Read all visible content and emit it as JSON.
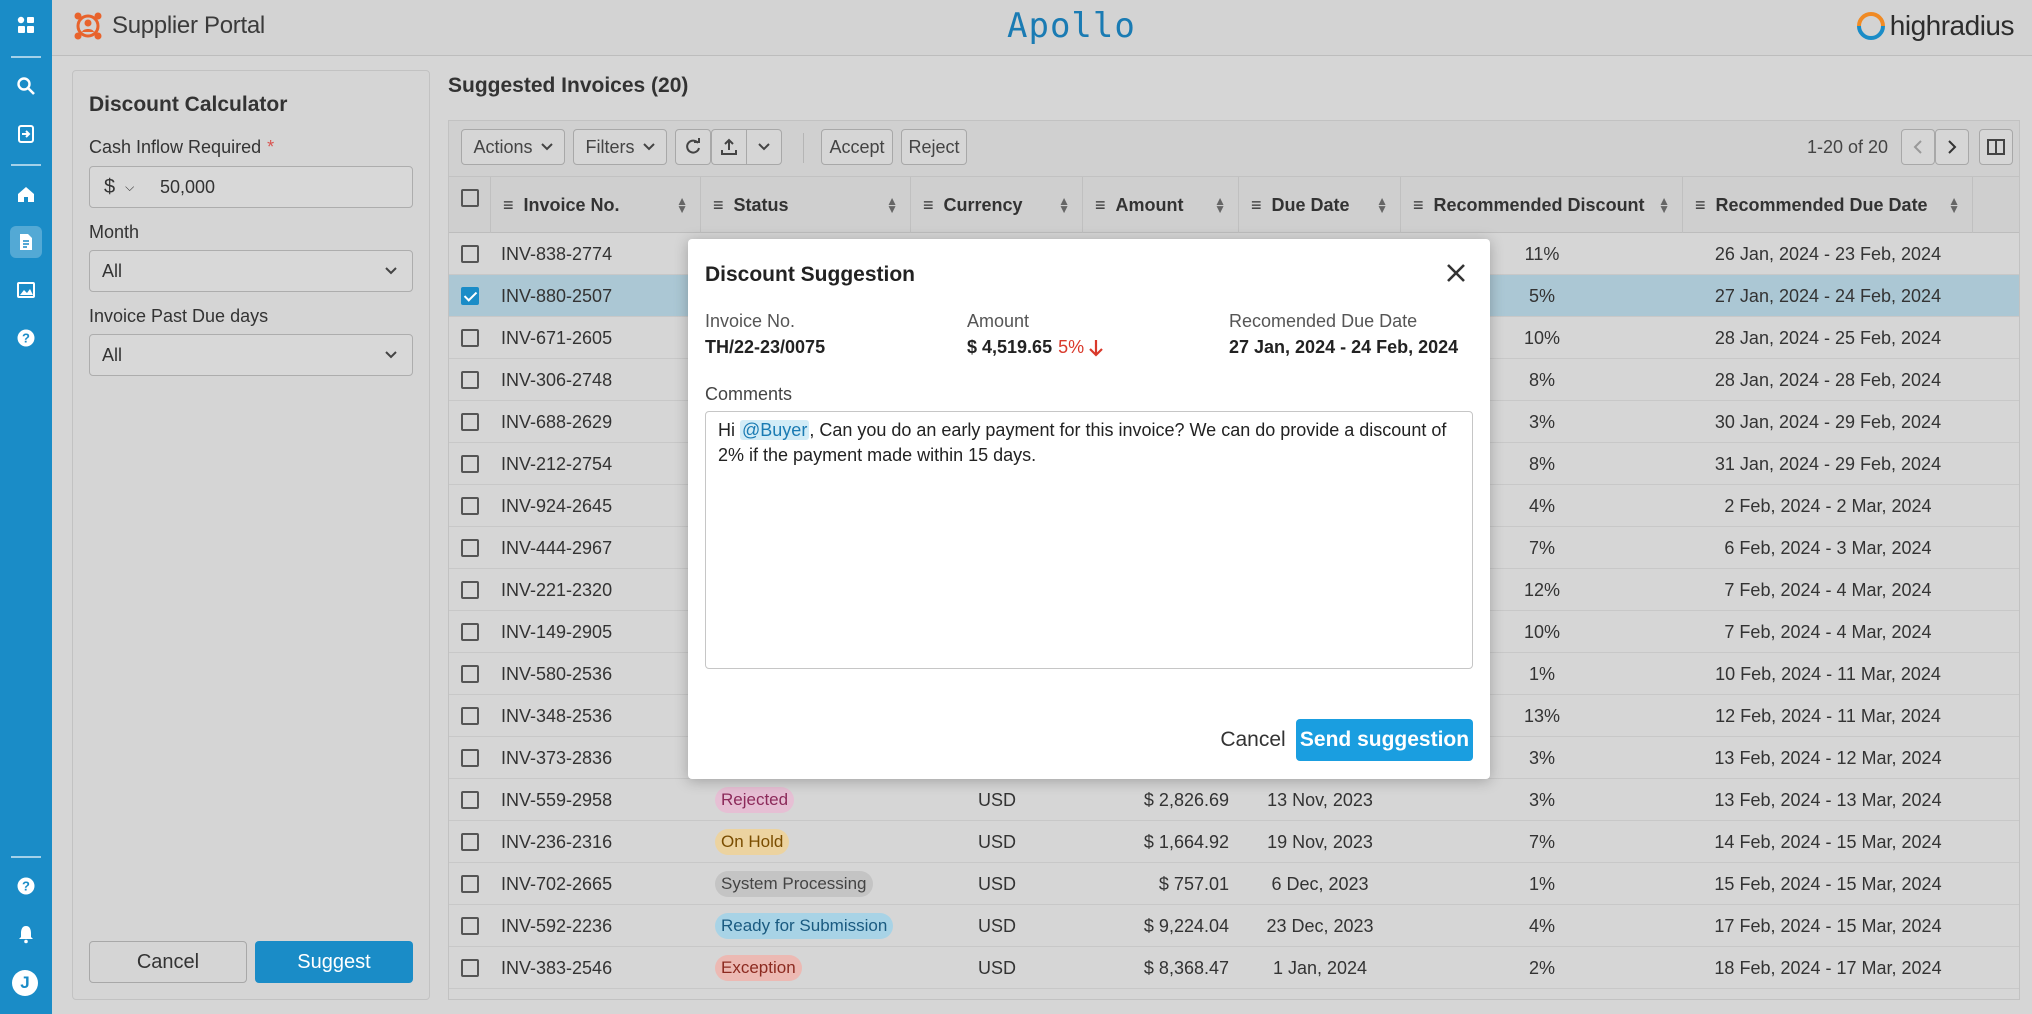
{
  "app": {
    "portal_name": "Supplier Portal",
    "center_logo": "Apollo",
    "brand": "highradius",
    "user_initial": "J",
    "rail_icons": [
      "apps-icon",
      "search-icon",
      "login-icon",
      "home-icon",
      "document-icon",
      "image-icon",
      "help-icon",
      "help-circle-icon",
      "bell-icon"
    ]
  },
  "calculator": {
    "title": "Discount Calculator",
    "cash_label": "Cash Inflow Required",
    "required_mark": "*",
    "currency_symbol": "$",
    "cash_value": "50,000",
    "month_label": "Month",
    "month_value": "All",
    "past_due_label": "Invoice Past Due days",
    "past_due_value": "All",
    "cancel": "Cancel",
    "suggest": "Suggest"
  },
  "main": {
    "title": "Suggested Invoices (20)",
    "toolbar": {
      "actions": "Actions",
      "filters": "Filters",
      "accept": "Accept",
      "reject": "Reject",
      "pagination": "1-20 of 20"
    },
    "columns": [
      "Invoice No.",
      "Status",
      "Currency",
      "Amount",
      "Due Date",
      "Recommended Discount",
      "Recommended Due Date"
    ],
    "rows": [
      {
        "inv": "INV-838-2774",
        "status": "",
        "cur": "",
        "amt": "",
        "due": "",
        "disc": "11%",
        "rdue": "26 Jan, 2024 - 23 Feb, 2024",
        "checked": false
      },
      {
        "inv": "INV-880-2507",
        "status": "",
        "cur": "",
        "amt": "",
        "due": "",
        "disc": "5%",
        "rdue": "27 Jan, 2024 - 24 Feb, 2024",
        "checked": true
      },
      {
        "inv": "INV-671-2605",
        "status": "",
        "cur": "",
        "amt": "",
        "due": "",
        "disc": "10%",
        "rdue": "28 Jan, 2024 - 25 Feb, 2024",
        "checked": false
      },
      {
        "inv": "INV-306-2748",
        "status": "",
        "cur": "",
        "amt": "",
        "due": "",
        "disc": "8%",
        "rdue": "28 Jan, 2024 - 28 Feb, 2024",
        "checked": false
      },
      {
        "inv": "INV-688-2629",
        "status": "",
        "cur": "",
        "amt": "",
        "due": "",
        "disc": "3%",
        "rdue": "30 Jan, 2024 - 29 Feb, 2024",
        "checked": false
      },
      {
        "inv": "INV-212-2754",
        "status": "",
        "cur": "",
        "amt": "",
        "due": "",
        "disc": "8%",
        "rdue": "31 Jan, 2024 - 29 Feb, 2024",
        "checked": false
      },
      {
        "inv": "INV-924-2645",
        "status": "",
        "cur": "",
        "amt": "",
        "due": "",
        "disc": "4%",
        "rdue": "2 Feb, 2024 - 2 Mar, 2024",
        "checked": false
      },
      {
        "inv": "INV-444-2967",
        "status": "",
        "cur": "",
        "amt": "",
        "due": "",
        "disc": "7%",
        "rdue": "6 Feb, 2024 - 3 Mar, 2024",
        "checked": false
      },
      {
        "inv": "INV-221-2320",
        "status": "",
        "cur": "",
        "amt": "",
        "due": "",
        "disc": "12%",
        "rdue": "7 Feb, 2024 - 4 Mar, 2024",
        "checked": false
      },
      {
        "inv": "INV-149-2905",
        "status": "",
        "cur": "",
        "amt": "",
        "due": "",
        "disc": "10%",
        "rdue": "7 Feb, 2024 - 4 Mar, 2024",
        "checked": false
      },
      {
        "inv": "INV-580-2536",
        "status": "",
        "cur": "",
        "amt": "",
        "due": "",
        "disc": "1%",
        "rdue": "10 Feb, 2024 - 11 Mar, 2024",
        "checked": false
      },
      {
        "inv": "INV-348-2536",
        "status": "",
        "cur": "",
        "amt": "",
        "due": "",
        "disc": "13%",
        "rdue": "12 Feb, 2024 - 11 Mar, 2024",
        "checked": false
      },
      {
        "inv": "INV-373-2836",
        "status": "",
        "cur": "",
        "amt": "",
        "due": "",
        "disc": "3%",
        "rdue": "13 Feb, 2024 - 12 Mar, 2024",
        "checked": false
      },
      {
        "inv": "INV-559-2958",
        "status": "Rejected",
        "cur": "USD",
        "amt": "$ 2,826.69",
        "due": "13 Nov, 2023",
        "disc": "3%",
        "rdue": "13 Feb, 2024 - 13 Mar, 2024",
        "checked": false
      },
      {
        "inv": "INV-236-2316",
        "status": "On Hold",
        "cur": "USD",
        "amt": "$ 1,664.92",
        "due": "19 Nov, 2023",
        "disc": "7%",
        "rdue": "14 Feb, 2024 - 15 Mar, 2024",
        "checked": false
      },
      {
        "inv": "INV-702-2665",
        "status": "System Processing",
        "cur": "USD",
        "amt": "$ 757.01",
        "due": "6 Dec, 2023",
        "disc": "1%",
        "rdue": "15 Feb, 2024 - 15 Mar, 2024",
        "checked": false
      },
      {
        "inv": "INV-592-2236",
        "status": "Ready for Submission",
        "cur": "USD",
        "amt": "$ 9,224.04",
        "due": "23 Dec, 2023",
        "disc": "4%",
        "rdue": "17 Feb, 2024 - 15 Mar, 2024",
        "checked": false
      },
      {
        "inv": "INV-383-2546",
        "status": "Exception",
        "cur": "USD",
        "amt": "$ 8,368.47",
        "due": "1 Jan, 2024",
        "disc": "2%",
        "rdue": "18 Feb, 2024 - 17 Mar, 2024",
        "checked": false
      }
    ],
    "status_colors": {
      "Rejected": {
        "bg": "#e6bfd4",
        "fg": "#8c2a5a"
      },
      "On Hold": {
        "bg": "#ecd3a0",
        "fg": "#7a4d00"
      },
      "System Processing": {
        "bg": "#c4c4c4",
        "fg": "#444444"
      },
      "Ready for Submission": {
        "bg": "#a8d3e6",
        "fg": "#1a5a80"
      },
      "Exception": {
        "bg": "#ecb9b3",
        "fg": "#8c2a20"
      }
    }
  },
  "modal": {
    "title": "Discount Suggestion",
    "invoice_label": "Invoice No.",
    "invoice_value": "TH/22-23/0075",
    "amount_label": "Amount",
    "amount_value": "$ 4,519.65",
    "discount": "5%",
    "due_label": "Recomended Due Date",
    "due_value": "27 Jan, 2024 - 24 Feb, 2024",
    "comments_label": "Comments",
    "comment_prefix": "Hi",
    "mention": "@Buyer",
    "comment_body": ", Can you do an early payment for this invoice? We can do provide a discount of 2% if the payment made within 15 days.",
    "cancel": "Cancel",
    "send": "Send suggestion"
  }
}
